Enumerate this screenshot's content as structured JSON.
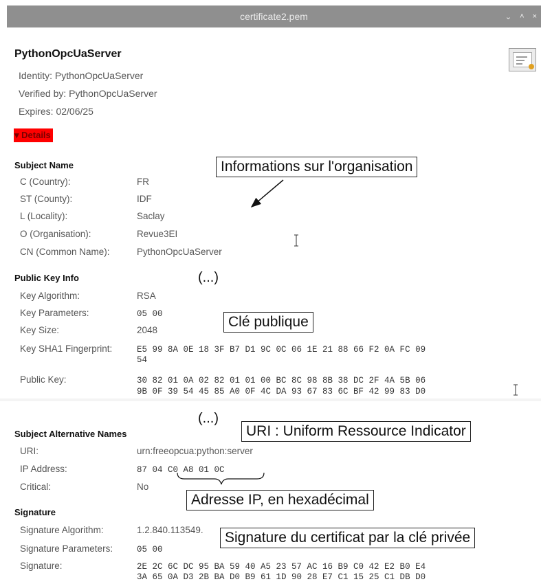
{
  "window": {
    "title": "certificate2.pem",
    "controls": [
      "⌄",
      "˄",
      "×"
    ]
  },
  "certificate": {
    "name": "PythonOpcUaServer",
    "identity": "Identity: PythonOpcUaServer",
    "verified_by": "Verified by: PythonOpcUaServer",
    "expires": "Expires: 02/06/25",
    "details_toggle": "▾ Details"
  },
  "subject_name": {
    "heading": "Subject Name",
    "rows": [
      {
        "label": "C (Country):",
        "value": "FR"
      },
      {
        "label": "ST (County):",
        "value": "IDF"
      },
      {
        "label": "L (Locality):",
        "value": "Saclay"
      },
      {
        "label": "O (Organisation):",
        "value": "Revue3EI"
      },
      {
        "label": "CN (Common Name):",
        "value": "PythonOpcUaServer"
      }
    ]
  },
  "public_key_info": {
    "heading": "Public Key Info",
    "rows": [
      {
        "label": "Key Algorithm:",
        "value": "RSA"
      },
      {
        "label": "Key Parameters:",
        "value": "05 00"
      },
      {
        "label": "Key Size:",
        "value": "2048"
      },
      {
        "label": "Key SHA1 Fingerprint:",
        "line1": "E5 99 8A 0E 18 3F B7 D1 9C 0C 06 1E 21 88 66 F2 0A FC 09",
        "line2": "54"
      },
      {
        "label": "Public Key:",
        "line1": "30 82 01 0A 02 82 01 01 00 BC 8C 98 8B 38 DC 2F 4A 5B 06",
        "line2": "9B 0F 39 54 45 85 A0 0F 4C DA 93 67 83 6C BF 42 99 83 D0"
      }
    ]
  },
  "subject_alt_names": {
    "heading": "Subject Alternative Names",
    "rows": [
      {
        "label": "URI:",
        "value": "urn:freeopcua:python:server"
      },
      {
        "label": "IP Address:",
        "value": "87 04 C0 A8 01 0C"
      },
      {
        "label": "Critical:",
        "value": "No"
      }
    ]
  },
  "signature": {
    "heading": "Signature",
    "rows": [
      {
        "label": "Signature Algorithm:",
        "value": "1.2.840.113549."
      },
      {
        "label": "Signature Parameters:",
        "value": "05 00"
      },
      {
        "label": "Signature:",
        "line1": "2E 2C 6C DC 95 BA 59 40 A5 23 57 AC 16 B9 C0 42 E2 B0 E4",
        "line2": "3A 65 0A D3 2B BA D0 B9 61 1D 90 28 E7 C1 15 25 C1 DB D0"
      }
    ]
  },
  "annotations": {
    "organisation": "Informations sur l'organisation",
    "public_key": "Clé publique",
    "uri": "URI : Uniform Ressource Indicator",
    "ip_hex": "Adresse IP, en hexadécimal",
    "signature": "Signature du certificat par la clé privée",
    "ellipsis_1": "(...)",
    "ellipsis_2": "(...)"
  }
}
